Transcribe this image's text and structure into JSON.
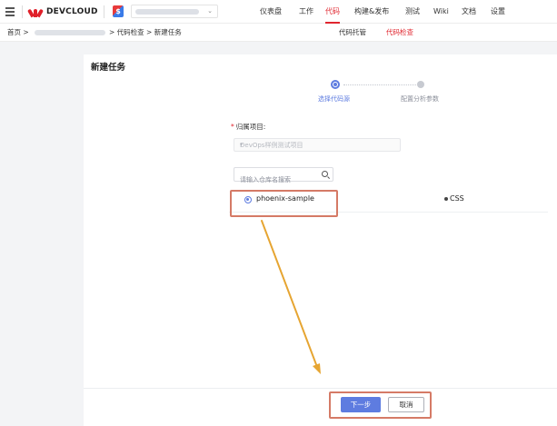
{
  "header": {
    "logo_text": "DEVCLOUD",
    "project_icon_text": "$",
    "nav": [
      {
        "label": "仪表盘",
        "active": false
      },
      {
        "label": "工作",
        "active": false
      },
      {
        "label": "代码",
        "active": true
      },
      {
        "label": "构建&发布",
        "active": false
      },
      {
        "label": "测试",
        "active": false
      },
      {
        "label": "Wiki",
        "active": false
      },
      {
        "label": "文档",
        "active": false
      },
      {
        "label": "设置",
        "active": false
      }
    ]
  },
  "breadcrumb": {
    "home": "首页 >",
    "rest": "> 代码检查 > 新建任务"
  },
  "subtabs": [
    {
      "label": "代码托管",
      "active": false
    },
    {
      "label": "代码检查",
      "active": true
    }
  ],
  "page": {
    "title": "新建任务",
    "steps": [
      {
        "label": "选择代码源",
        "active": true
      },
      {
        "label": "配置分析参数",
        "active": false
      }
    ],
    "form": {
      "required_mark": "*",
      "project_label": "归属项目:",
      "project_value": "DevOps样例测试项目",
      "search_placeholder": "请输入仓库名搜索"
    },
    "repos": [
      {
        "name": "phoenix-sample",
        "language": "CSS",
        "selected": true
      }
    ],
    "buttons": {
      "next": "下一步",
      "cancel": "取消"
    }
  },
  "colors": {
    "accent": "#5e7ce0",
    "brand_red": "#e0252e",
    "annotation": "#d57a66"
  }
}
